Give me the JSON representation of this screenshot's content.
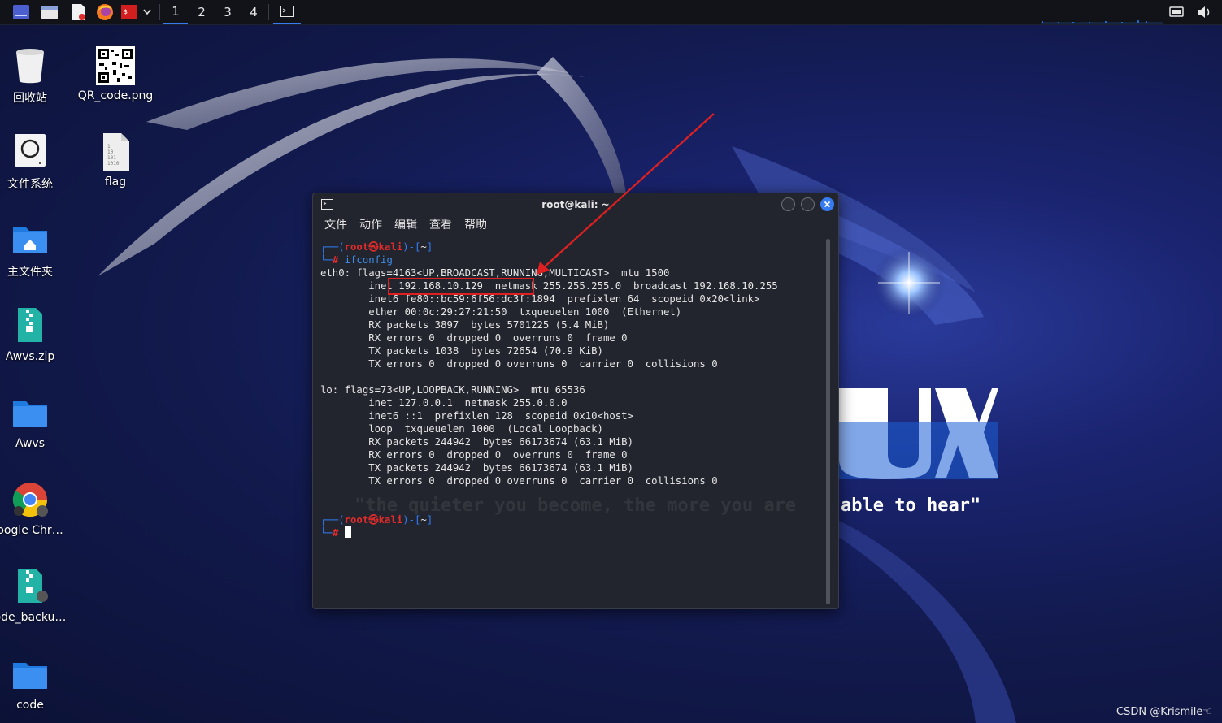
{
  "taskbar": {
    "workspaces": [
      "1",
      "2",
      "3",
      "4"
    ],
    "active_workspace": "1"
  },
  "desktop": {
    "icons": [
      {
        "label": "回收站",
        "icon": "trash-icon"
      },
      {
        "label": "QR_code.png",
        "icon": "qr-image-icon"
      },
      {
        "label": "文件系统",
        "icon": "drive-icon"
      },
      {
        "label": "flag",
        "icon": "binary-file-icon"
      },
      {
        "label": "主文件夹",
        "icon": "home-folder-icon"
      },
      {
        "label": "Awvs.zip",
        "icon": "zip-file-icon"
      },
      {
        "label": "Awvs",
        "icon": "folder-icon"
      },
      {
        "label": "oogle Chr…",
        "icon": "chrome-icon"
      },
      {
        "label": "ode_backu…",
        "icon": "zip-file-icon"
      },
      {
        "label": "code",
        "icon": "folder-icon"
      }
    ]
  },
  "wallpaper": {
    "logo_text": "KALI LINUX",
    "logo_visible_part": "UX",
    "slogan_left": "\"the quieter you become, the more you are",
    "slogan_right": "able to hear\""
  },
  "terminal": {
    "title": "root@kali: ~",
    "menu": [
      "文件",
      "动作",
      "编辑",
      "查看",
      "帮助"
    ],
    "prompt_user": "root",
    "prompt_at": "㉿",
    "prompt_host": "kali",
    "prompt_dir": "~",
    "command": "ifconfig",
    "output": [
      "eth0: flags=4163<UP,BROADCAST,RUNNING,MULTICAST>  mtu 1500",
      "        inet 192.168.10.129  netmask 255.255.255.0  broadcast 192.168.10.255",
      "        inet6 fe80::bc59:6f56:dc3f:1894  prefixlen 64  scopeid 0x20<link>",
      "        ether 00:0c:29:27:21:50  txqueuelen 1000  (Ethernet)",
      "        RX packets 3897  bytes 5701225 (5.4 MiB)",
      "        RX errors 0  dropped 0  overruns 0  frame 0",
      "        TX packets 1038  bytes 72654 (70.9 KiB)",
      "        TX errors 0  dropped 0 overruns 0  carrier 0  collisions 0",
      "",
      "lo: flags=73<UP,LOOPBACK,RUNNING>  mtu 65536",
      "        inet 127.0.0.1  netmask 255.0.0.0",
      "        inet6 ::1  prefixlen 128  scopeid 0x10<host>",
      "        loop  txqueuelen 1000  (Local Loopback)",
      "        RX packets 244942  bytes 66173674 (63.1 MiB)",
      "        RX errors 0  dropped 0  overruns 0  frame 0",
      "        TX packets 244942  bytes 66173674 (63.1 MiB)",
      "        TX errors 0  dropped 0 overruns 0  carrier 0  collisions 0",
      ""
    ]
  },
  "watermark": "CSDN @Krismile☜",
  "colors": {
    "accent": "#367bf0",
    "highlight_box": "#e02020",
    "prompt_user": "#e02b2b",
    "prompt_frame": "#2e7cf6"
  }
}
